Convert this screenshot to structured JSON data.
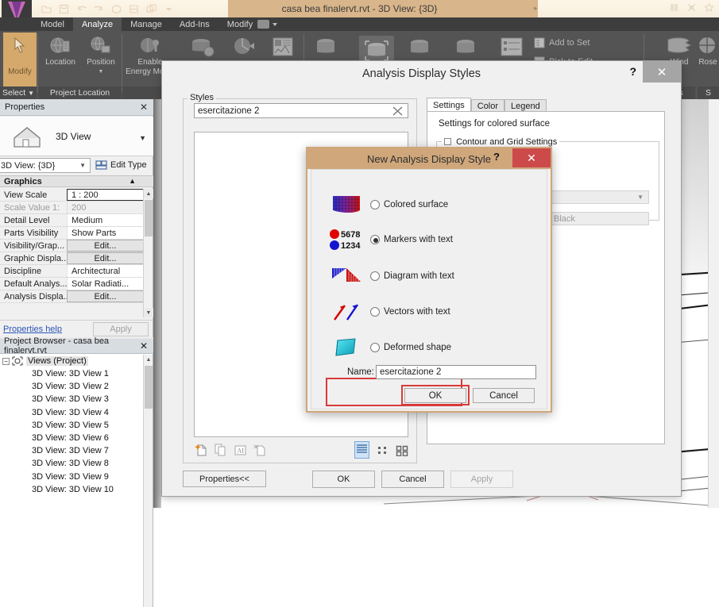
{
  "app": {
    "title": "casa bea finalervt.rvt - 3D View: {3D}",
    "quick_access": [
      "open-icon",
      "save-icon",
      "undo-icon",
      "redo-icon",
      "3d-view-icon",
      "section-icon",
      "tile-windows-icon",
      "dropdown-icon"
    ],
    "title_right_icons": [
      "help-icon",
      "signin-icon",
      "favorites-icon"
    ],
    "ribbon_tabs": [
      {
        "label": "Model",
        "active": false
      },
      {
        "label": "Analyze",
        "active": true
      },
      {
        "label": "Manage",
        "active": false
      },
      {
        "label": "Add-Ins",
        "active": false
      },
      {
        "label": "Modify",
        "active": false
      }
    ]
  },
  "ribbon": {
    "modify_button": "Modify",
    "select_panel_label": "Select",
    "panels": [
      {
        "label": "Project Location"
      },
      {
        "label": ""
      },
      {
        "label": ""
      }
    ],
    "buttons": [
      {
        "name": "location-button",
        "label": "Location",
        "icon": "globe-location-icon"
      },
      {
        "name": "position-button",
        "label": "Position",
        "icon": "globe-position-icon"
      },
      {
        "name": "enable-energy-model-button",
        "label": "Enable Energy Model",
        "icon": "energy-model-icon"
      },
      {
        "name": "energy-settings-button",
        "label": "",
        "icon": "energy-settings-icon"
      },
      {
        "name": "heating-cooling-loads-button",
        "label": "",
        "icon": "loads-icon"
      },
      {
        "name": "reports-button",
        "label": "",
        "icon": "reports-icon"
      },
      {
        "name": "system-browser-button",
        "label": "",
        "icon": "system-browser-icon"
      }
    ],
    "set_items": [
      {
        "label": "Add to Set",
        "icon": "add-to-set-icon"
      },
      {
        "label": "Pick to Edit",
        "icon": "pick-to-edit-icon"
      }
    ],
    "right_buttons": [
      {
        "label": "Wind",
        "icon": "wind-icon"
      },
      {
        "label": "Rose",
        "icon": "rose-icon"
      }
    ],
    "right_panel_labels": [
      "alysis",
      "S"
    ]
  },
  "properties": {
    "header": "Properties",
    "close_icon": "close-icon",
    "type_icon": "house-icon",
    "type_label": "3D View",
    "selector_value": "3D View: {3D}",
    "edit_type_label": "Edit Type",
    "group_label": "Graphics",
    "rows": [
      {
        "key": "View Scale",
        "value": "1 : 200",
        "kind": "selected"
      },
      {
        "key": "Scale Value   1:",
        "value": "200",
        "kind": "disabled"
      },
      {
        "key": "Detail Level",
        "value": "Medium",
        "kind": "text"
      },
      {
        "key": "Parts Visibility",
        "value": "Show Parts",
        "kind": "text"
      },
      {
        "key": "Visibility/Grap...",
        "value": "Edit...",
        "kind": "button"
      },
      {
        "key": "Graphic Displa...",
        "value": "Edit...",
        "kind": "button"
      },
      {
        "key": "Discipline",
        "value": "Architectural",
        "kind": "text"
      },
      {
        "key": "Default Analys...",
        "value": "Solar Radiati...",
        "kind": "text"
      },
      {
        "key": "Analysis Displa...",
        "value": "Edit...",
        "kind": "button"
      }
    ],
    "help_link": "Properties help",
    "apply_button": "Apply"
  },
  "project_browser": {
    "header": "Project Browser - casa bea finalervt.rvt",
    "close_icon": "close-icon",
    "root_label": "Views (Project)",
    "root_icon": "views-icon",
    "items": [
      "3D View: 3D View 1",
      "3D View: 3D View 2",
      "3D View: 3D View 3",
      "3D View: 3D View 4",
      "3D View: 3D View 5",
      "3D View: 3D View 6",
      "3D View: 3D View 7",
      "3D View: 3D View 8",
      "3D View: 3D View 9",
      "3D View: 3D View 10"
    ]
  },
  "analysis_dialog": {
    "title": "Analysis Display Styles",
    "help_icon": "?",
    "close_icon": "close-icon",
    "styles_group_label": "Styles",
    "styles_combo_value": "esercitazione 2",
    "styles_combo_clear_icon": "clear-x-icon",
    "list_tools": [
      {
        "name": "new-style-icon"
      },
      {
        "name": "duplicate-style-icon"
      },
      {
        "name": "rename-style-icon"
      },
      {
        "name": "delete-style-icon"
      }
    ],
    "view_tools": [
      {
        "name": "list-view-icon",
        "selected": true
      },
      {
        "name": "small-icons-view-icon",
        "selected": false
      },
      {
        "name": "large-icons-view-icon",
        "selected": false
      }
    ],
    "properties_button": "Properties<<",
    "tabs": [
      {
        "label": "Settings",
        "active": true
      },
      {
        "label": "Color",
        "active": false
      },
      {
        "label": "Legend",
        "active": false
      }
    ],
    "settings_heading": "Settings for colored surface",
    "contour_group_label": "Contour and Grid Settings",
    "color_field_value": "Black",
    "buttons": {
      "ok": "OK",
      "cancel": "Cancel",
      "apply": "Apply"
    }
  },
  "new_style_dialog": {
    "title": "New Analysis Display Style",
    "help_icon": "?",
    "close_icon": "close-icon",
    "options": [
      {
        "label": "Colored surface",
        "selected": false,
        "icon": "colored-surface-icon",
        "highlighted": false
      },
      {
        "label": "Markers with text",
        "selected": true,
        "icon": "markers-with-text-icon",
        "highlighted": true,
        "marker_values": [
          "5678",
          "1234"
        ]
      },
      {
        "label": "Diagram with text",
        "selected": false,
        "icon": "diagram-with-text-icon",
        "highlighted": false
      },
      {
        "label": "Vectors with text",
        "selected": false,
        "icon": "vectors-with-text-icon",
        "highlighted": false
      },
      {
        "label": "Deformed shape",
        "selected": false,
        "icon": "deformed-shape-icon",
        "highlighted": false
      }
    ],
    "name_label": "Name:",
    "name_value": "esercitazione 2",
    "ok_button": "OK",
    "cancel_button": "Cancel"
  },
  "colors": {
    "highlight_red": "#d93a3a",
    "inner_dialog_title": "#cfa77b",
    "close_red": "#cc4a4a",
    "ribbon_dark": "#545454",
    "modify_orange": "#d5a96b",
    "marker_red": "#e00000",
    "marker_blue": "#1414d0"
  }
}
